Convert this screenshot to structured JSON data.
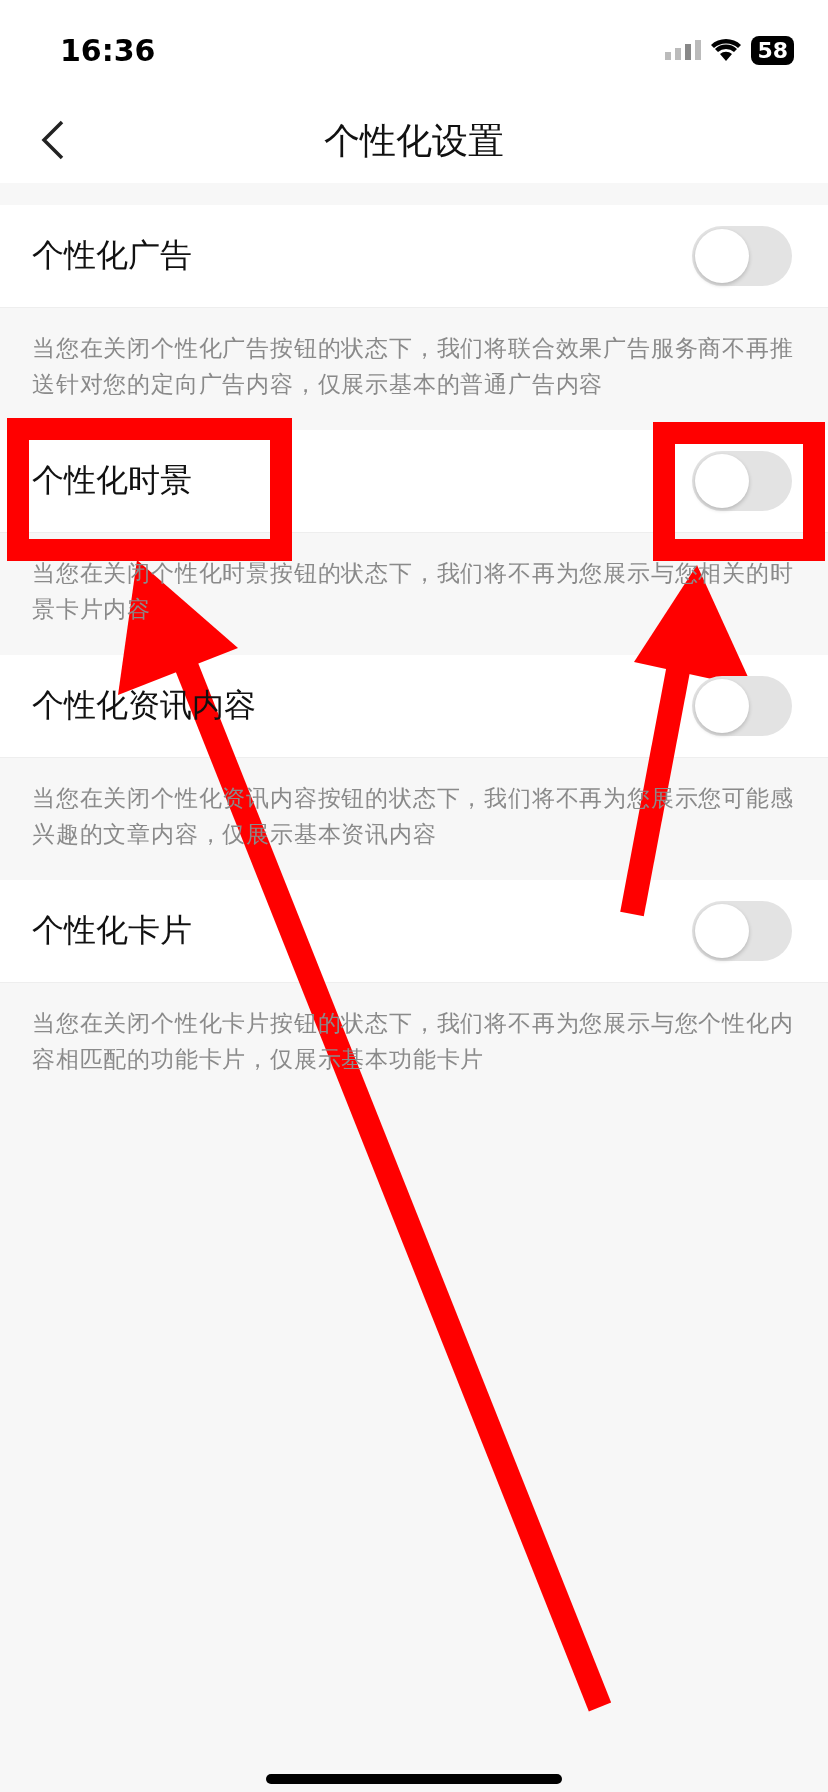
{
  "status_bar": {
    "time": "16:36",
    "battery": "58"
  },
  "header": {
    "title": "个性化设置"
  },
  "settings": [
    {
      "label": "个性化广告",
      "on": false,
      "description": "当您在关闭个性化广告按钮的状态下，我们将联合效果广告服务商不再推送针对您的定向广告内容，仅展示基本的普通广告内容"
    },
    {
      "label": "个性化时景",
      "on": false,
      "description": "当您在关闭个性化时景按钮的状态下，我们将不再为您展示与您相关的时景卡片内容"
    },
    {
      "label": "个性化资讯内容",
      "on": false,
      "description": "当您在关闭个性化资讯内容按钮的状态下，我们将不再为您展示您可能感兴趣的文章内容，仅展示基本资讯内容"
    },
    {
      "label": "个性化卡片",
      "on": false,
      "description": "当您在关闭个性化卡片按钮的状态下，我们将不再为您展示与您个性化内容相匹配的功能卡片，仅展示基本功能卡片"
    }
  ]
}
